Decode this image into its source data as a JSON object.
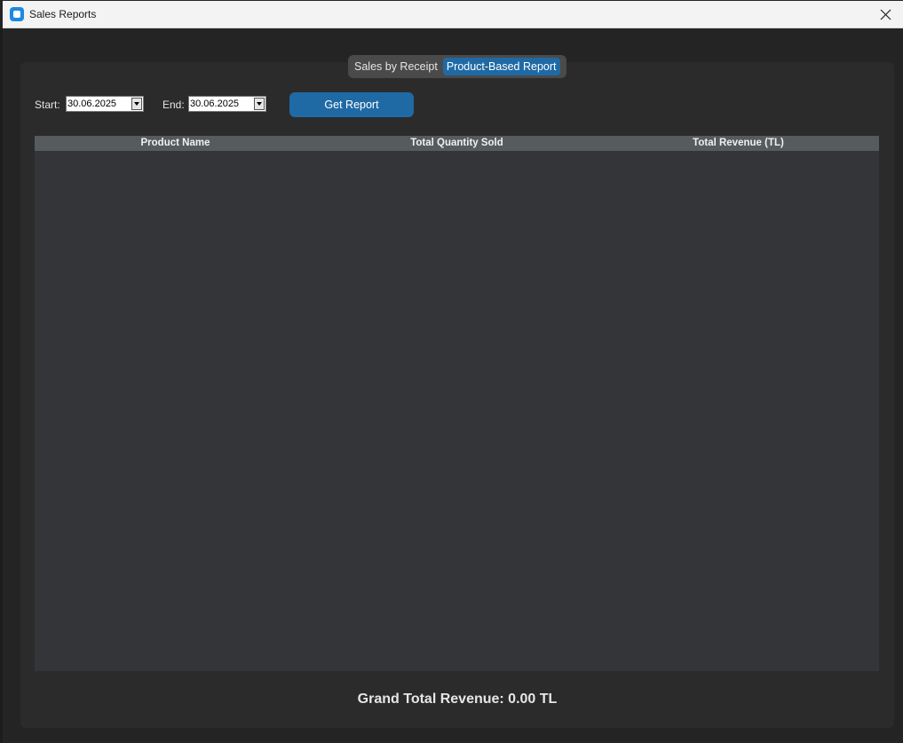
{
  "window": {
    "title": "Sales Reports"
  },
  "tabs": [
    {
      "label": "Sales by Receipt",
      "active": false
    },
    {
      "label": "Product-Based Report",
      "active": true
    }
  ],
  "filters": {
    "start_label": "Start:",
    "start_value": "30.06.2025",
    "end_label": "End:",
    "end_value": "30.06.2025",
    "button_label": "Get Report"
  },
  "table": {
    "columns": [
      "Product Name",
      "Total Quantity Sold",
      "Total Revenue (TL)"
    ],
    "rows": []
  },
  "summary": {
    "grand_total": "Grand Total Revenue: 0.00 TL"
  },
  "colors": {
    "accent": "#1f6aa5",
    "panel": "#2b2b2b",
    "table_bg": "#333538",
    "header_bg": "#565b5e"
  }
}
